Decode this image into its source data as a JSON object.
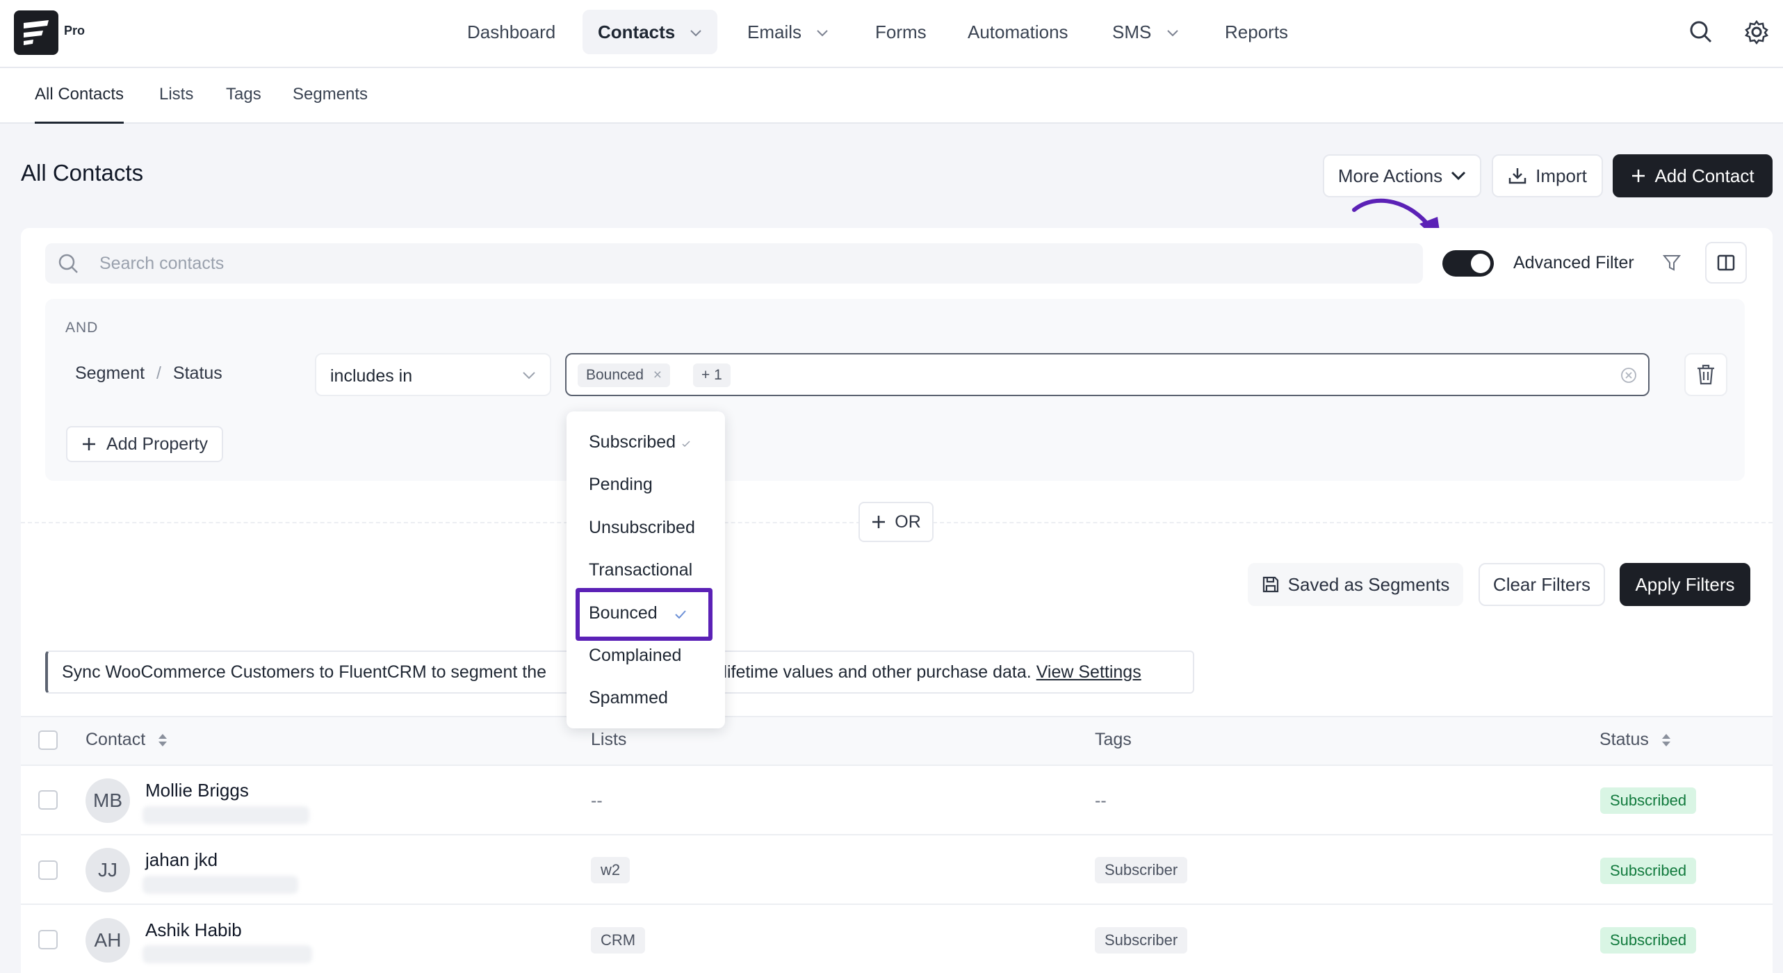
{
  "app": {
    "pro_badge": "Pro"
  },
  "nav": {
    "items": [
      {
        "label": "Dashboard"
      },
      {
        "label": "Contacts"
      },
      {
        "label": "Emails"
      },
      {
        "label": "Forms"
      },
      {
        "label": "Automations"
      },
      {
        "label": "SMS"
      },
      {
        "label": "Reports"
      }
    ],
    "active": "Contacts",
    "icons": [
      "search-icon",
      "gear-icon"
    ]
  },
  "subnav": {
    "items": [
      {
        "label": "All Contacts"
      },
      {
        "label": "Lists"
      },
      {
        "label": "Tags"
      },
      {
        "label": "Segments"
      }
    ],
    "active": "All Contacts"
  },
  "page": {
    "title": "All Contacts",
    "more_actions": "More Actions",
    "import": "Import",
    "add_contact": "Add Contact"
  },
  "search": {
    "placeholder": "Search contacts"
  },
  "advanced_filter": {
    "label": "Advanced Filter",
    "enabled": true
  },
  "filter": {
    "group_label": "AND",
    "property": {
      "segment": "Segment",
      "separator": "/",
      "field": "Status"
    },
    "operator": "includes in",
    "selected_chip": "Bounced",
    "more_count": "+ 1",
    "add_property": "Add Property",
    "or_label": "OR",
    "options": [
      {
        "label": "Subscribed",
        "selected": true
      },
      {
        "label": "Pending",
        "selected": false
      },
      {
        "label": "Unsubscribed",
        "selected": false
      },
      {
        "label": "Transactional",
        "selected": false
      },
      {
        "label": "Bounced",
        "selected": true
      },
      {
        "label": "Complained",
        "selected": false
      },
      {
        "label": "Spammed",
        "selected": false
      }
    ]
  },
  "actions": {
    "saved_segments": "Saved as Segments",
    "clear_filters": "Clear Filters",
    "apply_filters": "Apply Filters"
  },
  "notice": {
    "text_before": "Sync WooCommerce Customers to FluentCRM to segment the",
    "text_after": "s, lifetime values and other purchase data.",
    "link": "View Settings"
  },
  "table": {
    "columns": [
      "Contact",
      "Lists",
      "Tags",
      "Status"
    ],
    "rows": [
      {
        "initials": "MB",
        "name": "Mollie Briggs",
        "lists": "--",
        "tags": "--",
        "status": "Subscribed"
      },
      {
        "initials": "JJ",
        "name": "jahan jkd",
        "lists": "w2",
        "tags": "Subscriber",
        "status": "Subscribed"
      },
      {
        "initials": "AH",
        "name": "Ashik Habib",
        "lists": "CRM",
        "tags": "Subscriber",
        "status": "Subscribed"
      }
    ]
  },
  "colors": {
    "accent_dark": "#1c1f26",
    "highlight_purple": "#5b21b6",
    "status_green": "#d9f5e4"
  }
}
